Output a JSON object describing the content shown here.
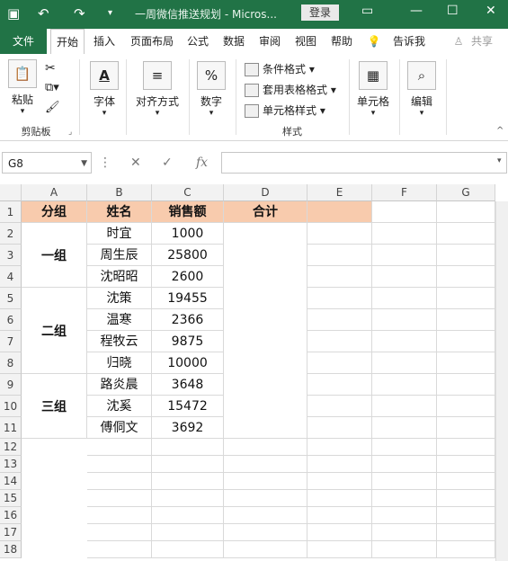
{
  "titlebar": {
    "title": "一周微信推送规划  -  Micros...",
    "login": "登录"
  },
  "tabs": [
    "文件",
    "开始",
    "插入",
    "页面布局",
    "公式",
    "数据",
    "审阅",
    "视图",
    "帮助",
    "告诉我",
    "共享"
  ],
  "ribbon": {
    "paste": "粘贴",
    "clipboard_label": "剪贴板",
    "font": "字体",
    "align": "对齐方式",
    "number": "数字",
    "conditional": "条件格式",
    "table_format": "套用表格格式",
    "cell_style": "单元格样式",
    "styles_label": "样式",
    "cells": "单元格",
    "edit": "编辑",
    "font_icon": "A",
    "number_icon": "%"
  },
  "formula_bar": {
    "name_box": "G8",
    "fx": "fx",
    "value": ""
  },
  "columns": [
    "A",
    "B",
    "C",
    "D",
    "E",
    "F",
    "G"
  ],
  "rows": [
    "1",
    "2",
    "3",
    "4",
    "5",
    "6",
    "7",
    "8",
    "9",
    "10",
    "11",
    "12",
    "13",
    "14",
    "15",
    "16",
    "17",
    "18"
  ],
  "table": {
    "headers": {
      "group": "分组",
      "name": "姓名",
      "sales": "销售额",
      "total": "合计"
    },
    "groups": [
      {
        "label": "一组",
        "members": [
          {
            "name": "时宜",
            "sales": "1000"
          },
          {
            "name": "周生辰",
            "sales": "25800"
          },
          {
            "name": "沈昭昭",
            "sales": "2600"
          }
        ]
      },
      {
        "label": "二组",
        "members": [
          {
            "name": "沈策",
            "sales": "19455"
          },
          {
            "name": "温寒",
            "sales": "2366"
          },
          {
            "name": "程牧云",
            "sales": "9875"
          },
          {
            "name": "归晓",
            "sales": "10000"
          }
        ]
      },
      {
        "label": "三组",
        "members": [
          {
            "name": "路炎晨",
            "sales": "3648"
          },
          {
            "name": "沈奚",
            "sales": "15472"
          },
          {
            "name": "傅侗文",
            "sales": "3692"
          }
        ]
      }
    ]
  },
  "colors": {
    "excel_green": "#217346",
    "header_fill": "#f8cbad"
  }
}
